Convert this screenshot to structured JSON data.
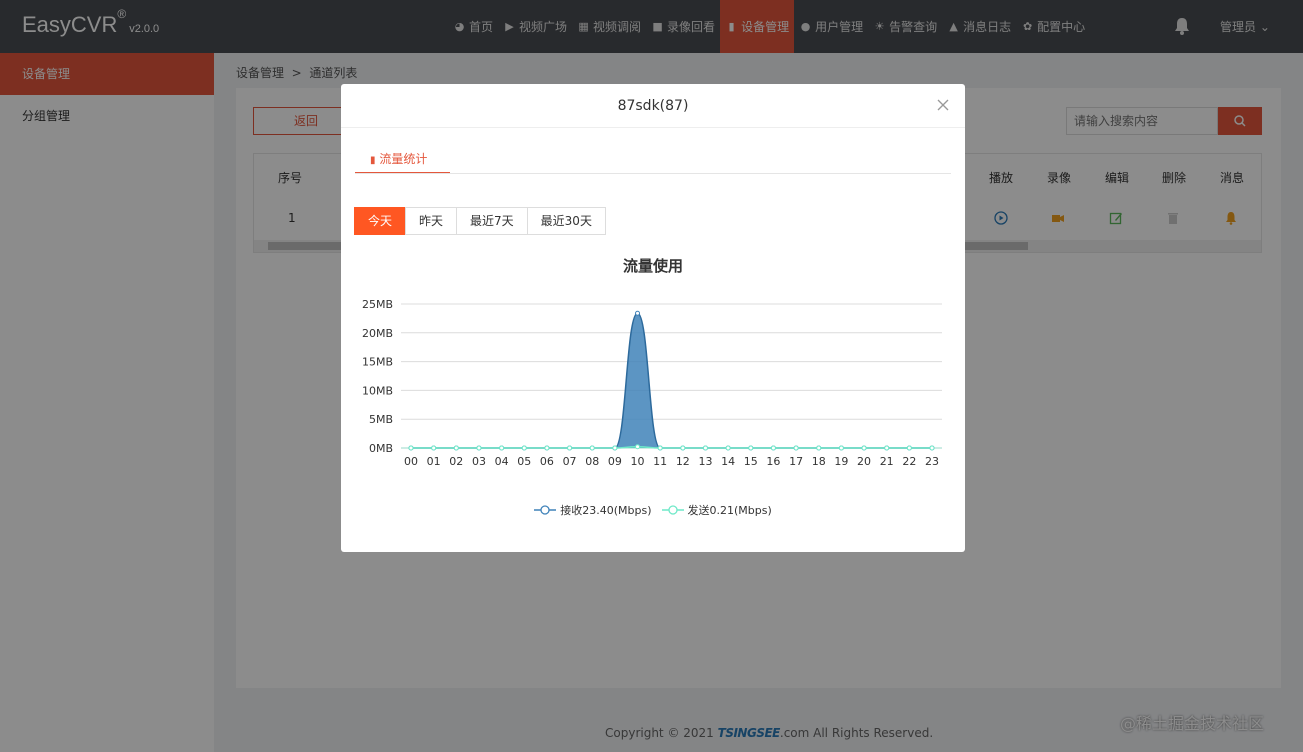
{
  "app": {
    "name": "EasyCVR",
    "reg": "®",
    "version": "v2.0.0"
  },
  "nav": [
    {
      "label": "首页",
      "icon": "dashboard-icon",
      "glyph": "◕"
    },
    {
      "label": "视频广场",
      "icon": "play-circle-icon",
      "glyph": "▶"
    },
    {
      "label": "视频调阅",
      "icon": "grid-icon",
      "glyph": "▦"
    },
    {
      "label": "录像回看",
      "icon": "video-camera-icon",
      "glyph": "■"
    },
    {
      "label": "设备管理",
      "icon": "columns-icon",
      "glyph": "▮",
      "active": true
    },
    {
      "label": "用户管理",
      "icon": "user-icon",
      "glyph": "●"
    },
    {
      "label": "告警查询",
      "icon": "alarm-icon",
      "glyph": "☀"
    },
    {
      "label": "消息日志",
      "icon": "bell-icon",
      "glyph": "▲"
    },
    {
      "label": "配置中心",
      "icon": "gear-icon",
      "glyph": "✿"
    }
  ],
  "user": {
    "label": "管理员"
  },
  "sidebar": [
    {
      "label": "设备管理",
      "active": true
    },
    {
      "label": "分组管理"
    }
  ],
  "breadcrumb": {
    "parent": "设备管理",
    "sep": ">",
    "current": "通道列表"
  },
  "toolbar": {
    "back_label": "返回",
    "search_placeholder": "请输入搜索内容"
  },
  "table": {
    "headers": [
      "序号",
      "播放",
      "录像",
      "编辑",
      "删除",
      "消息"
    ],
    "row": {
      "index": "1"
    },
    "op_colors": {
      "play": "#2a7ab9",
      "record": "#f0a020",
      "edit": "#5cb85c",
      "delete": "#cccccc",
      "message": "#f0a020"
    }
  },
  "footer": {
    "prefix": "Copyright © 2021",
    "brand": "TSINGSEE",
    "suffix": ".com All Rights Reserved."
  },
  "watermark": "@稀土掘金技术社区",
  "modal": {
    "title": "87sdk(87)",
    "tab_label": "流量统计",
    "ranges": [
      {
        "label": "今天",
        "active": true
      },
      {
        "label": "昨天"
      },
      {
        "label": "最近7天"
      },
      {
        "label": "最近30天"
      }
    ]
  },
  "colors": {
    "accent": "#e4573c",
    "active_range": "#ff5722",
    "receive": "#3f82b9",
    "send": "#6ee9c8"
  },
  "chart_data": {
    "type": "area",
    "title": "流量使用",
    "x": [
      "00",
      "01",
      "02",
      "03",
      "04",
      "05",
      "06",
      "07",
      "08",
      "09",
      "10",
      "11",
      "12",
      "13",
      "14",
      "15",
      "16",
      "17",
      "18",
      "19",
      "20",
      "21",
      "22",
      "23"
    ],
    "y_ticks": [
      "0MB",
      "5MB",
      "10MB",
      "15MB",
      "20MB",
      "25MB"
    ],
    "ylim": [
      0,
      25
    ],
    "series": [
      {
        "name": "接收23.40(Mbps)",
        "values": [
          0,
          0,
          0,
          0,
          0,
          0,
          0,
          0,
          0,
          0,
          23.4,
          0,
          0,
          0,
          0,
          0,
          0,
          0,
          0,
          0,
          0,
          0,
          0,
          0
        ]
      },
      {
        "name": "发送0.21(Mbps)",
        "values": [
          0,
          0,
          0,
          0,
          0,
          0,
          0,
          0,
          0,
          0,
          0.21,
          0,
          0,
          0,
          0,
          0,
          0,
          0,
          0,
          0,
          0,
          0,
          0,
          0
        ]
      }
    ],
    "grid": true,
    "legend": "bottom"
  }
}
